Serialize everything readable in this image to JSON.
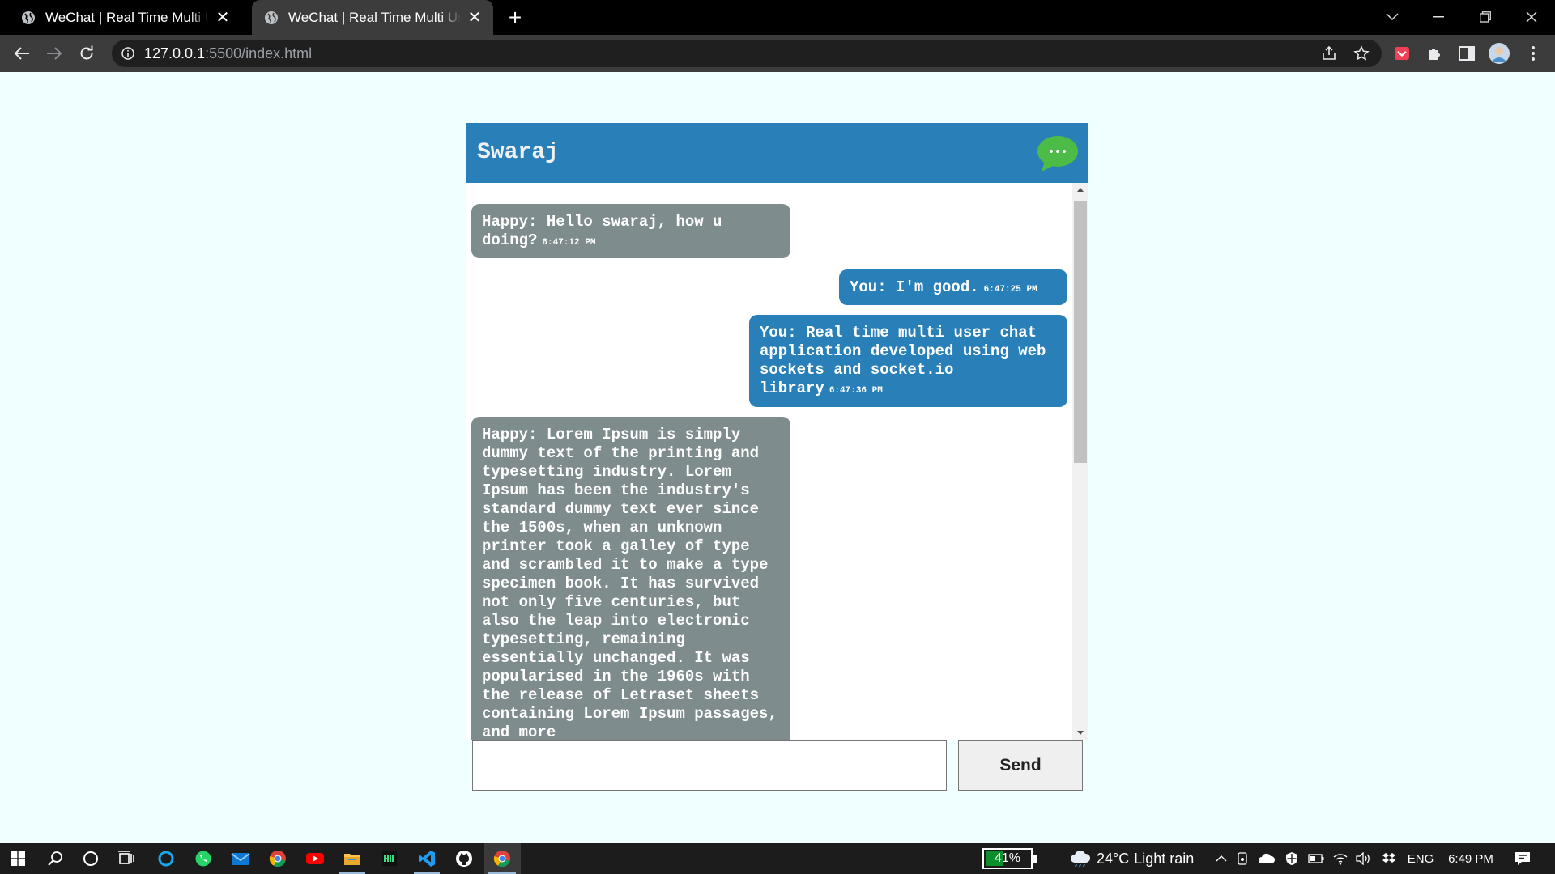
{
  "browser": {
    "tabs": [
      {
        "title": "WeChat | Real Time Multi User Chat",
        "active": false
      },
      {
        "title": "WeChat | Real Time Multi User Chat",
        "active": true
      }
    ],
    "url_host": "127.0.0.1",
    "url_rest": ":5500/index.html"
  },
  "chat": {
    "title": "Swaraj",
    "logo_icon": "chat-bubble-icon",
    "messages": [
      {
        "direction": "incoming",
        "text": "Happy: Hello swaraj, how u doing?",
        "time": "6:47:12 PM"
      },
      {
        "direction": "outgoing",
        "text": "You: I'm good.",
        "time": "6:47:25 PM"
      },
      {
        "direction": "outgoing",
        "text": "You: Real time multi user chat application developed using web sockets and socket.io library",
        "time": "6:47:36 PM"
      },
      {
        "direction": "incoming",
        "text": "Happy: Lorem Ipsum is simply dummy text of the printing and typesetting industry. Lorem Ipsum has been the industry's standard dummy text ever since the 1500s, when an unknown printer took a galley of type and scrambled it to make a type specimen book. It has survived not only five centuries, but also the leap into electronic typesetting, remaining essentially unchanged. It was popularised in the 1960s with the release of Letraset sheets containing Lorem Ipsum passages, and more",
        "time": ""
      }
    ],
    "input_value": "",
    "send_label": "Send"
  },
  "taskbar": {
    "battery": "41%",
    "battery_level": 0.41,
    "weather_temp": "24°C",
    "weather_desc": "Light rain",
    "language": "ENG",
    "clock": "6:49 PM"
  },
  "colors": {
    "page_bg": "#f0ffff",
    "header_bg": "#2980b9",
    "incoming_bubble": "#7f8c8d",
    "outgoing_bubble": "#2980b9",
    "logo_green": "#4cbb47"
  }
}
